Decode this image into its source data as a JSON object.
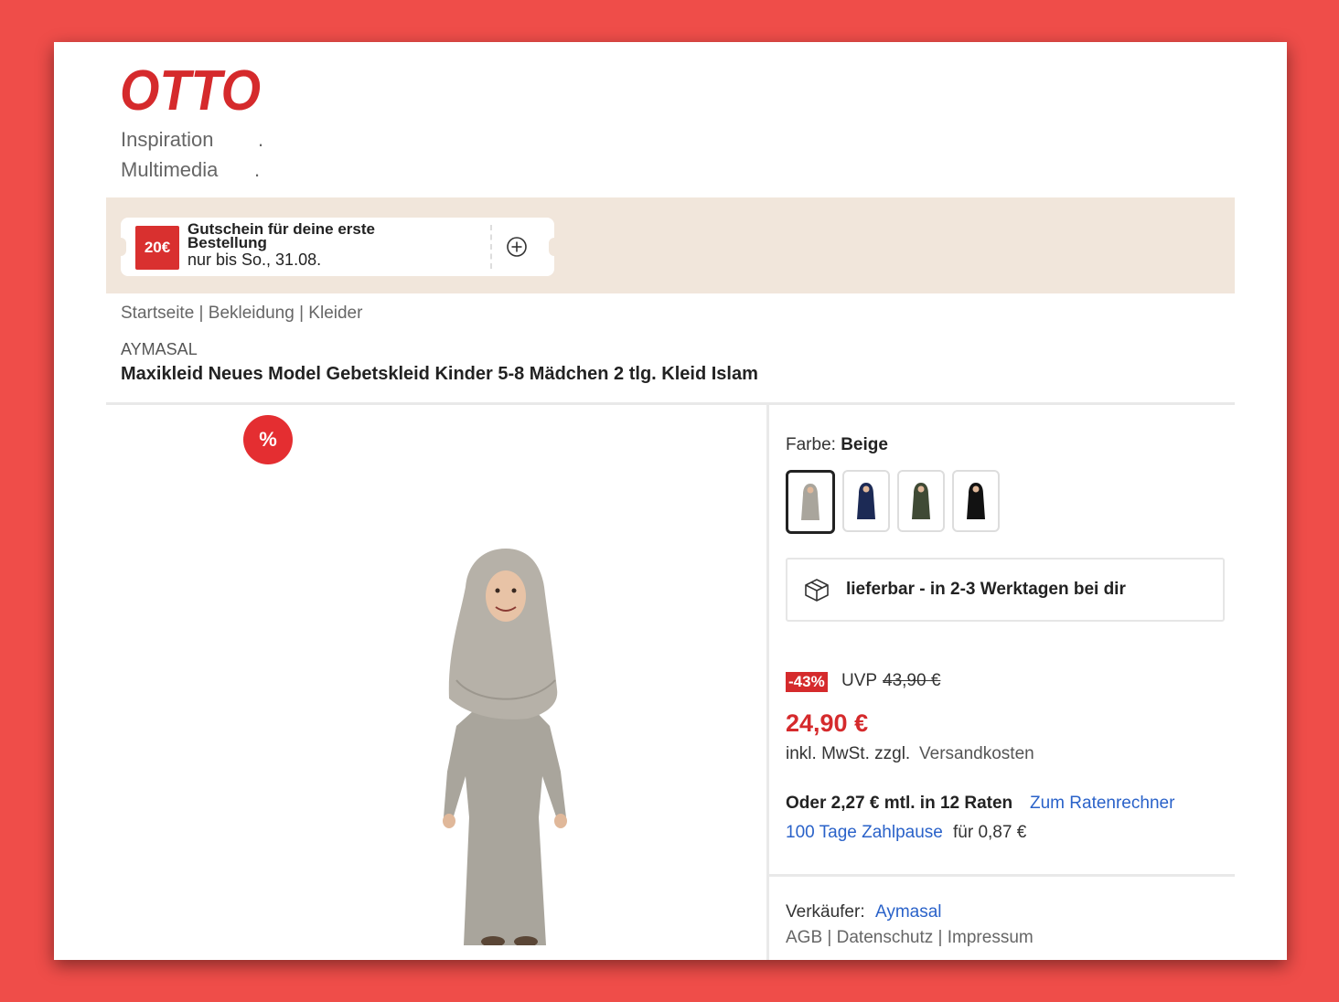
{
  "brand_logo": {
    "text": "OTTO",
    "color": "#d52a2c"
  },
  "nav": {
    "items": [
      "Inspiration",
      "Multimedia"
    ],
    "dot": "."
  },
  "coupon": {
    "badge": "20€",
    "title": "Gutschein für deine erste Bestellung",
    "date": "nur bis So., 31.08.",
    "icon": "plus-circle-icon"
  },
  "breadcrumb": {
    "items": [
      "Startseite",
      "Bekleidung",
      "Kleider"
    ],
    "separator": " | "
  },
  "product": {
    "brand": "AYMASAL",
    "title": "Maxikleid Neues Model Gebetskleid Kinder 5-8 Mädchen 2 tlg. Kleid Islam",
    "sale_badge": "%"
  },
  "color": {
    "label": "Farbe: ",
    "selected": "Beige",
    "swatches": [
      {
        "name": "Beige",
        "color": "#a9a59c",
        "selected": true
      },
      {
        "name": "Navy",
        "color": "#1c2a55",
        "selected": false
      },
      {
        "name": "Oliv",
        "color": "#3f4a35",
        "selected": false
      },
      {
        "name": "Schwarz",
        "color": "#121212",
        "selected": false
      }
    ]
  },
  "delivery": {
    "icon": "package-icon",
    "text": "lieferbar - in 2-3 Werktagen bei dir"
  },
  "pricing": {
    "discount": "-43%",
    "uvp_label": "UVP",
    "uvp_old": "43,90 €",
    "price": "24,90 €",
    "tax_text": "inkl. MwSt. zzgl.",
    "shipping_link": "Versandkosten",
    "rates_text": "Oder 2,27 € mtl. in 12 Raten",
    "rates_link": "Zum Ratenrechner",
    "pause_link": "100 Tage Zahlpause",
    "pause_rest": "für 0,87 €"
  },
  "seller": {
    "label": "Verkäufer:",
    "name": "Aymasal",
    "links": [
      "AGB",
      "Datenschutz",
      "Impressum"
    ]
  },
  "colors": {
    "accent": "#d52a2c",
    "link": "#2a62c9",
    "banner": "#f1e6db"
  }
}
